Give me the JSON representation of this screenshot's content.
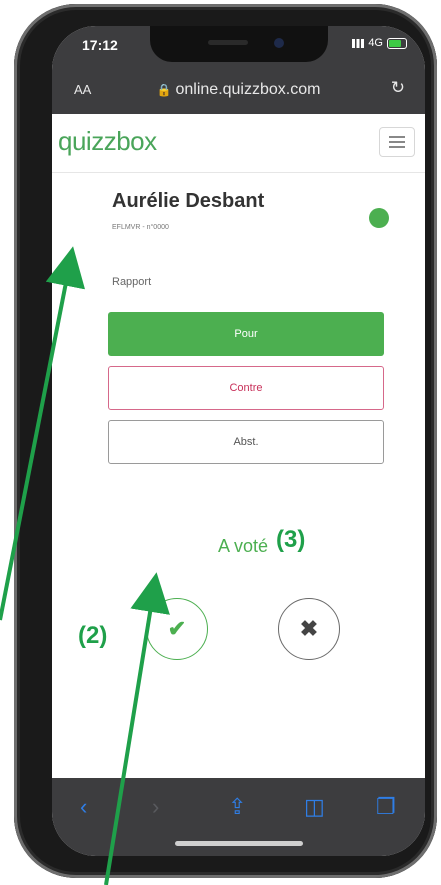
{
  "status": {
    "time": "17:12",
    "network": "4G"
  },
  "browser": {
    "aa": "AA",
    "url": "online.quizzbox.com"
  },
  "app": {
    "logo": "quizzbox"
  },
  "voter": {
    "name": "Aurélie Desbant",
    "subtitle": "EFLMVR - n°0000",
    "status_color": "#4caf50"
  },
  "section": {
    "label": "Rapport"
  },
  "buttons": {
    "pour": "Pour",
    "contre": "Contre",
    "abst": "Abst."
  },
  "vote_state": {
    "label": "A voté"
  },
  "annotations": {
    "two": "(2)",
    "three": "(3)"
  },
  "icons": [
    "lock-icon",
    "reload-icon",
    "hamburger-menu-icon",
    "check-icon",
    "close-icon",
    "back-icon",
    "forward-icon",
    "share-icon",
    "bookmarks-icon",
    "tabs-icon"
  ],
  "colors": {
    "accent": "#4caf50",
    "logo": "#4aa55a",
    "contre": "#c8305a",
    "toolbar": "#3d3d3f",
    "link": "#2f7ee6"
  }
}
